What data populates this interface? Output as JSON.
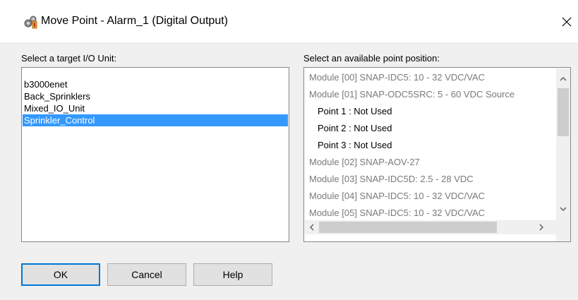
{
  "window": {
    "title": "Move Point - Alarm_1 (Digital Output)"
  },
  "icons": {
    "app": "gears-icon",
    "close": "close-icon"
  },
  "labels": {
    "target_unit": "Select a target I/O Unit:",
    "point_position": "Select an available point position:"
  },
  "io_units": [
    {
      "label": "b3000enet",
      "selected": false
    },
    {
      "label": "Back_Sprinklers",
      "selected": false
    },
    {
      "label": "Mixed_IO_Unit",
      "selected": false
    },
    {
      "label": "Sprinkler_Control",
      "selected": true
    }
  ],
  "positions": [
    {
      "label": "Module [00] SNAP-IDC5: 10 - 32 VDC/VAC",
      "kind": "module"
    },
    {
      "label": "Module [01] SNAP-ODC5SRC: 5 - 60 VDC Source",
      "kind": "module"
    },
    {
      "label": "Point 1 : Not Used",
      "kind": "point"
    },
    {
      "label": "Point 2 : Not Used",
      "kind": "point"
    },
    {
      "label": "Point 3 : Not Used",
      "kind": "point"
    },
    {
      "label": "Module [02] SNAP-AOV-27",
      "kind": "module"
    },
    {
      "label": "Module [03] SNAP-IDC5D: 2.5 - 28 VDC",
      "kind": "module"
    },
    {
      "label": "Module [04] SNAP-IDC5: 10 - 32 VDC/VAC",
      "kind": "module"
    },
    {
      "label": "Module [05] SNAP-IDC5: 10 - 32 VDC/VAC",
      "kind": "module"
    }
  ],
  "buttons": {
    "ok": "OK",
    "cancel": "Cancel",
    "help": "Help"
  },
  "colors": {
    "selection": "#3399ff",
    "default_button_border": "#0078d7"
  }
}
